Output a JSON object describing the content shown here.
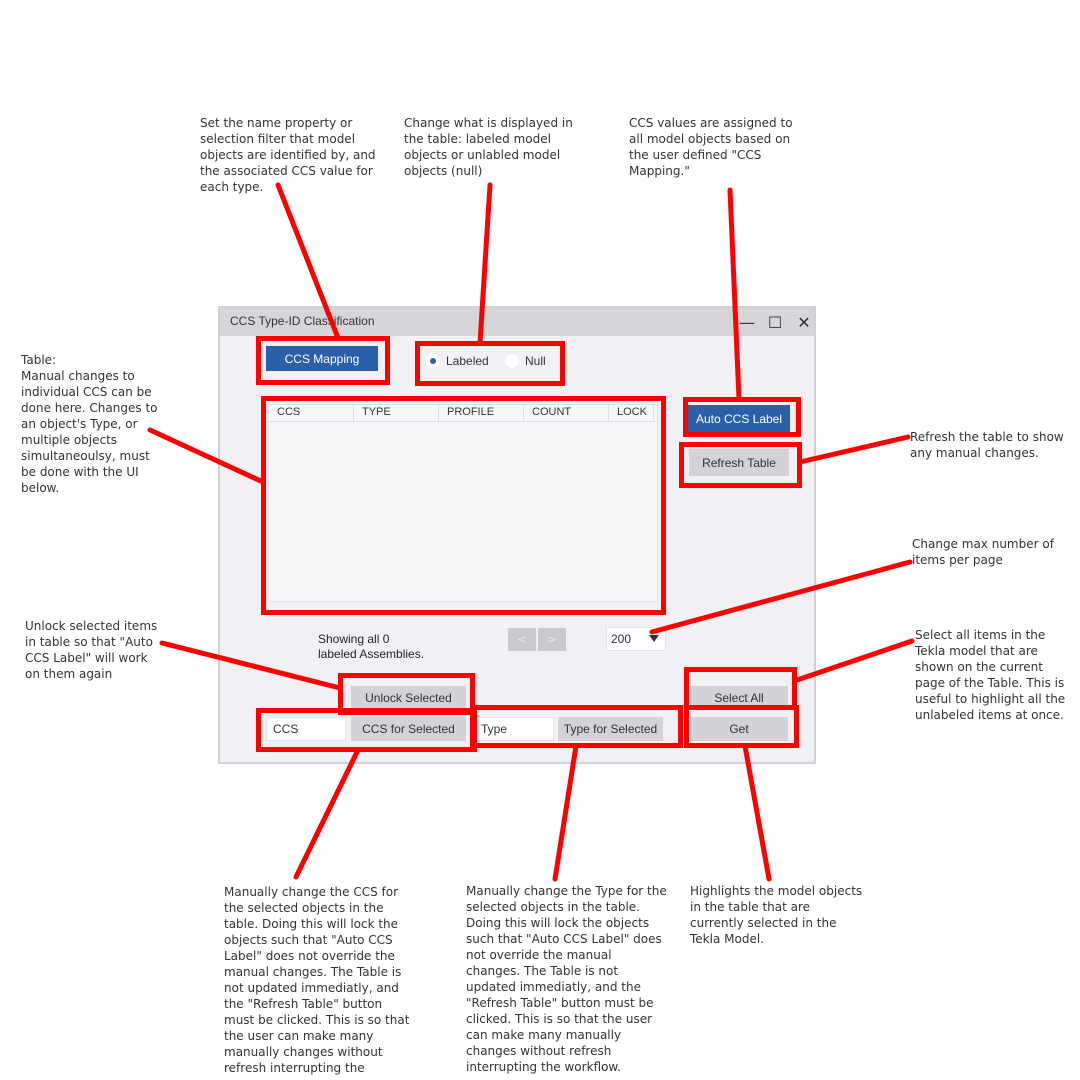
{
  "window": {
    "title": "CCS Type-ID Classification",
    "controls": {
      "minimize": "—",
      "maximize": "☐",
      "close": "✕"
    }
  },
  "toolbar": {
    "ccs_mapping_label": "CCS Mapping",
    "auto_ccs_label": "Auto CCS Label",
    "refresh_table_label": "Refresh Table"
  },
  "filter": {
    "options": [
      {
        "label": "Labeled",
        "selected": true
      },
      {
        "label": "Null",
        "selected": false
      }
    ]
  },
  "table": {
    "columns": [
      "CCS",
      "TYPE",
      "PROFILE",
      "COUNT",
      "LOCK"
    ],
    "rows": []
  },
  "paging": {
    "status": "Showing all 0\nlabeled Assemblies.",
    "prev_label": "<",
    "next_label": ">",
    "page_size": "200"
  },
  "actions": {
    "unlock_selected_label": "Unlock Selected",
    "select_all_label": "Select All",
    "ccs_input_value": "CCS",
    "ccs_for_selected_label": "CCS for Selected",
    "type_input_value": "Type",
    "type_for_selected_label": "Type for Selected",
    "get_label": "Get"
  },
  "annotations": {
    "ccs_mapping": "Set the name property or\nselection filter that model\nobjects are identified by, and\nthe associated CCS value for\neach type.",
    "filter": "Change what is displayed in\nthe table: labeled model\nobjects or unlabled model\nobjects (null)",
    "auto_ccs": "CCS values are assigned to\nall model objects based on\nthe user defined \"CCS\nMapping.\"",
    "table": "Table:\nManual changes to\nindividual CCS can be\ndone here.  Changes to\nan object's Type, or\nmultiple objects\nsimultaneoulsy, must\nbe done with the UI\nbelow.",
    "refresh": "Refresh the table to show\nany manual changes.",
    "page_size": "Change max number of\nitems per page",
    "unlock": "Unlock selected items\nin table so that \"Auto\nCCS Label\" will work\non them again",
    "select_all": "Select all items in the\nTekla model that are\nshown on the current\npage of the Table.  This is\nuseful to highlight all the\nunlabeled items at once.",
    "ccs_for_selected": "Manually change the CCS for\nthe selected objects in the\ntable.  Doing this will lock the\nobjects such that \"Auto CCS\nLabel\" does not override the\nmanual changes.  The Table is\nnot updated immediatly, and\nthe \"Refresh Table\" button\nmust be clicked.  This is so that\nthe user can make many\nmanually changes without\nrefresh interrupting the",
    "type_for_selected": "Manually change the Type for the\nselected objects in the table.\nDoing this will lock the objects\nsuch that \"Auto CCS Label\" does\nnot override the manual\nchanges.  The Table is not\nupdated immediatly, and the\n\"Refresh Table\" button must be\nclicked.  This is so that the user\ncan make many manually\nchanges without refresh\ninterrupting the workflow.",
    "get": "Highlights the model objects\nin the table that are\ncurrently selected in the\nTekla Model."
  },
  "colors": {
    "callout_red": "#ff0000",
    "primary_button": "#2b5fa8",
    "secondary_button": "#d2d2d8",
    "window_bg": "#f1f1f5"
  }
}
